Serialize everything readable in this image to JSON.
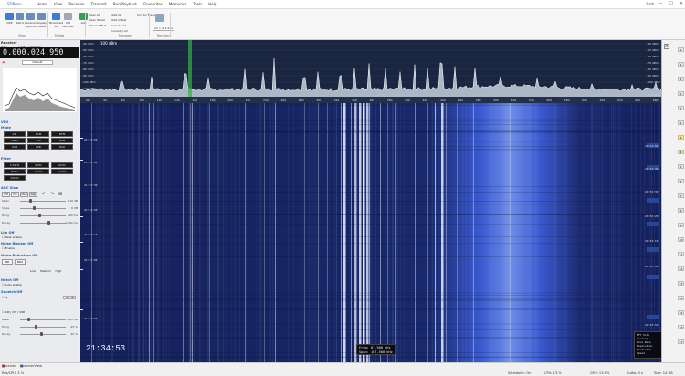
{
  "title_bar": {
    "app": "SDRuno",
    "menu": [
      "Home",
      "View",
      "Receiver",
      "Transmit",
      "Rec/Playback",
      "Favourites",
      "Memories",
      "Tools",
      "Help"
    ],
    "user": "Style",
    "controls": [
      "—",
      "☐",
      "✕"
    ]
  },
  "ribbon": {
    "buttons": [
      {
        "label": "DSP",
        "color": "#3a7bd5"
      },
      {
        "label": "Matrix",
        "color": "#6a8bbf"
      },
      {
        "label": "Receiver Options",
        "color": "#6a8bbf"
      },
      {
        "label": "Display Freeze",
        "color": "#6a8bbf"
      },
      {
        "label": "Broadcast Rx",
        "color": "#3a7bd5"
      },
      {
        "label": "CW Decoder",
        "color": "#9fa9b6"
      },
      {
        "label": "Add",
        "color": "#3a9b5d"
      }
    ],
    "small_buttons": [
      "Clear All",
      "Clear Offset",
      "Follow Offset",
      "Mute All",
      "Mute Offset",
      "Unmute All",
      "Sort by Frequency",
      "Currently All"
    ],
    "receivers_select": "Ch 1 / 14.950",
    "groups": [
      "View",
      "Modes",
      "Manager",
      "Receivers"
    ]
  },
  "left_panel": {
    "header": "Receiver",
    "rx_label": "RX 1",
    "rx_info": "1 SIN - 1/900 RX",
    "frequency": "0.000.024.950",
    "preset": "Default",
    "sections": {
      "vfo": "VFO",
      "mode": "Mode",
      "filter": "Filter",
      "agc": "AGC Slow",
      "limiter": "Lim Off",
      "noise_blanker": "Noise Blanker Off",
      "noise_reduction": "Noise Reduction Off",
      "notch": "Notch Off",
      "squelch": "Squelch Off"
    },
    "mode_buttons": [
      "AM",
      "SAM",
      "NFM",
      "WFM",
      "CW",
      "DSB",
      "USB",
      "LSB",
      "DIGI"
    ],
    "filter_buttons": [
      "2.5kHz",
      "4kHz",
      "6kHz",
      "8kHz",
      "10kHz",
      "12kHz",
      "15kHz"
    ],
    "agc_buttons": [
      "Off",
      "Fst",
      "Med",
      "Slw"
    ],
    "agc_sliders": [
      {
        "label": "Atten",
        "value": "110 dB"
      },
      {
        "label": "Slope",
        "value": "6 dB"
      },
      {
        "label": "Hang",
        "value": "500 ms"
      },
      {
        "label": "Decay",
        "value": "1000 ms"
      }
    ],
    "checkbox_labels": [
      "Peak enable",
      "Enable",
      "Auto enable",
      "AM | CW / SSB"
    ],
    "nr_buttons": [
      "NR",
      "NR2",
      "Low",
      "Medium",
      "High"
    ],
    "squelch_level": "-80 dB",
    "squelch_sliders": [
      {
        "label": "Level",
        "value": "-100 dB"
      },
      {
        "label": "Hang",
        "value": "25 %"
      },
      {
        "label": "Decay",
        "value": "20 %"
      }
    ]
  },
  "spectrum": {
    "db_labels": [
      "-40 dBm",
      "-50 dBm",
      "-60 dBm",
      "-70 dBm",
      "-80 dBm",
      "-90 dBm",
      "-100 dBm",
      "-110 dBm",
      "-120 dBm"
    ],
    "freq_labels": [
      "40",
      "60",
      "80",
      "100",
      "120",
      "140",
      "160",
      "180",
      "200",
      "220",
      "240",
      "260",
      "280",
      "300",
      "320",
      "340",
      "360",
      "380",
      "400",
      "420",
      "440",
      "460",
      "480",
      "500",
      "520",
      "540",
      "560",
      "580",
      "600",
      "620",
      "640",
      "660",
      "680"
    ],
    "peak_label": "100 dBm"
  },
  "waterfall": {
    "time_labels": [
      "21:34:50",
      "21:34:40",
      "21:34:30",
      "21:34:20",
      "21:34:10",
      "21:34:00",
      "21:33:50"
    ],
    "clock": "21:34:53",
    "freq_readout": "Freq: 87.500 kHz",
    "span_readout": "Span: 167.500 kHz",
    "info": [
      {
        "k": "FFT Size",
        "v": "128 K"
      },
      {
        "k": "Overlap",
        "v": "25 %"
      },
      {
        "k": "Line Rate",
        "v": "40 /s"
      },
      {
        "k": "Resolution",
        "v": "6.1 Hz"
      },
      {
        "k": "Bandwidth",
        "v": "Default"
      },
      {
        "k": "Speed",
        "v": "5"
      }
    ]
  },
  "right_strip": {
    "labels": [
      "1",
      "1",
      "1",
      "1",
      "1",
      "2",
      "3",
      "4",
      "5",
      "6",
      "7",
      "8",
      "9",
      "10",
      "11",
      "12",
      "13",
      "14",
      "15",
      "16",
      "17"
    ]
  },
  "status_bar": {
    "tabs": [
      "Receiver",
      "ReceiverView"
    ],
    "left_info": "Res/CPU: 3 %",
    "scheduler": "Scheduler: On",
    "cpu": "CPU: 13 %",
    "gpu": "GPU: 13.0%",
    "audio": "Audio: 0 s",
    "size": "Size: 14 GB"
  }
}
